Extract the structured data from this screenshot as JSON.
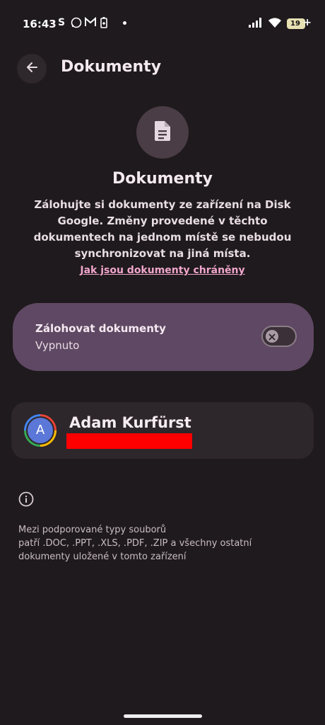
{
  "status_bar": {
    "time": "16:43",
    "battery_level": "19",
    "icons": [
      "s-app-icon",
      "whatsapp-icon",
      "gmail-icon",
      "battery-saver-icon",
      "dot-icon",
      "signal-icon",
      "wifi-icon",
      "battery-icon"
    ]
  },
  "header": {
    "title": "Dokumenty"
  },
  "hero": {
    "icon": "document-icon",
    "title": "Dokumenty",
    "description": "Zálohujte si dokumenty ze zařízení na Disk Google. Změny provedené v těchto dokumentech na jednom místě se nebudou synchronizovat na jiná místa.",
    "link": "Jak jsou dokumenty chráněny"
  },
  "backup": {
    "title": "Zálohovat dokumenty",
    "status": "Vypnuto",
    "enabled": false
  },
  "account": {
    "initial": "A",
    "name": "Adam Kurfürst"
  },
  "info": {
    "text_line1": "Mezi podporované typy souborů",
    "text_line2": "patří .DOC, .PPT, .XLS, .PDF, .ZIP a všechny ostatní",
    "text_line3": "dokumenty uložené v tomto zařízení"
  },
  "colors": {
    "background": "#1f1a1d",
    "card": "#5f4863",
    "link": "#f0a6cc",
    "redaction": "#ff0000"
  }
}
